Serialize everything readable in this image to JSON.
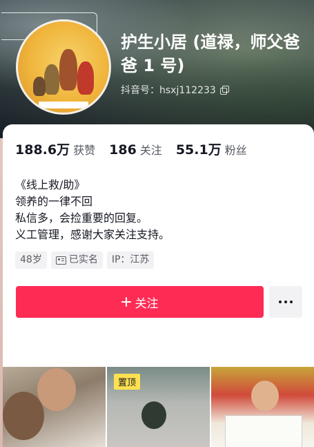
{
  "profile": {
    "name": "护生小居 (道禄，师父爸爸 1 号)",
    "douyin_id": "抖音号：hsxj112233"
  },
  "stats": [
    {
      "value": "188.6万",
      "label": "获赞"
    },
    {
      "value": "186",
      "label": "关注"
    },
    {
      "value": "55.1万",
      "label": "粉丝"
    }
  ],
  "bio": [
    "《线上救/助》",
    "领养的一律不回",
    "私信多，会捡重要的回复。",
    "义工管理，感谢大家关注支持。"
  ],
  "tags": {
    "age": "48岁",
    "verified": "已实名",
    "ip": "IP：江苏"
  },
  "actions": {
    "follow_label": "关注"
  },
  "videos": {
    "pinned_label": "置顶"
  },
  "colors": {
    "accent": "#fe2c55",
    "pinned_badge": "#ffe14f"
  }
}
